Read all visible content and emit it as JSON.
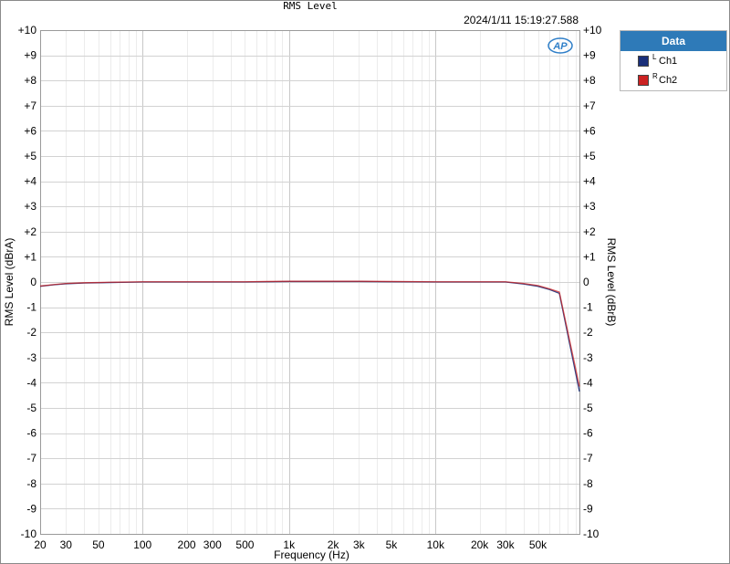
{
  "window": {
    "title": "RMS Level",
    "timestamp": "2024/1/11 15:19:27.588"
  },
  "legend": {
    "header": "Data",
    "items": [
      {
        "sup": "L",
        "label": "Ch1",
        "color": "#1a2f7a"
      },
      {
        "sup": "R",
        "label": "Ch2",
        "color": "#cc2222"
      }
    ]
  },
  "logo": {
    "text": "AP",
    "color": "#2f7fc8"
  },
  "chart_data": {
    "type": "line",
    "title": "RMS Level",
    "xlabel": "Frequency (Hz)",
    "ylabel_left": "RMS Level (dBrA)",
    "ylabel_right": "RMS Level (dBrB)",
    "x_scale": "log",
    "xlim": [
      20,
      96000
    ],
    "ylim": [
      -10,
      10
    ],
    "grid": true,
    "legend_position": "right-outside-top",
    "x_ticks": [
      {
        "v": 20,
        "l": "20"
      },
      {
        "v": 30,
        "l": "30"
      },
      {
        "v": 50,
        "l": "50"
      },
      {
        "v": 100,
        "l": "100"
      },
      {
        "v": 200,
        "l": "200"
      },
      {
        "v": 300,
        "l": "300"
      },
      {
        "v": 500,
        "l": "500"
      },
      {
        "v": 1000,
        "l": "1k"
      },
      {
        "v": 2000,
        "l": "2k"
      },
      {
        "v": 3000,
        "l": "3k"
      },
      {
        "v": 5000,
        "l": "5k"
      },
      {
        "v": 10000,
        "l": "10k"
      },
      {
        "v": 20000,
        "l": "20k"
      },
      {
        "v": 30000,
        "l": "30k"
      },
      {
        "v": 50000,
        "l": "50k"
      }
    ],
    "y_ticks": [
      {
        "v": 10,
        "l": "+10"
      },
      {
        "v": 9,
        "l": "+9"
      },
      {
        "v": 8,
        "l": "+8"
      },
      {
        "v": 7,
        "l": "+7"
      },
      {
        "v": 6,
        "l": "+6"
      },
      {
        "v": 5,
        "l": "+5"
      },
      {
        "v": 4,
        "l": "+4"
      },
      {
        "v": 3,
        "l": "+3"
      },
      {
        "v": 2,
        "l": "+2"
      },
      {
        "v": 1,
        "l": "+1"
      },
      {
        "v": 0,
        "l": "0"
      },
      {
        "v": -1,
        "l": "-1"
      },
      {
        "v": -2,
        "l": "-2"
      },
      {
        "v": -3,
        "l": "-3"
      },
      {
        "v": -4,
        "l": "-4"
      },
      {
        "v": -5,
        "l": "-5"
      },
      {
        "v": -6,
        "l": "-6"
      },
      {
        "v": -7,
        "l": "-7"
      },
      {
        "v": -8,
        "l": "-8"
      },
      {
        "v": -9,
        "l": "-9"
      },
      {
        "v": -10,
        "l": "-10"
      }
    ],
    "series": [
      {
        "name": "Ch1",
        "color": "#1a2f7a",
        "x": [
          20,
          25,
          30,
          40,
          50,
          60,
          80,
          100,
          200,
          500,
          700,
          1000,
          2000,
          3000,
          5000,
          10000,
          20000,
          30000,
          40000,
          50000,
          60000,
          70000,
          96000
        ],
        "y": [
          -0.17,
          -0.11,
          -0.07,
          -0.04,
          -0.03,
          -0.02,
          -0.01,
          0.0,
          0.0,
          0.0,
          0.01,
          0.02,
          0.02,
          0.02,
          0.01,
          0.0,
          0.0,
          0.0,
          -0.08,
          -0.17,
          -0.3,
          -0.45,
          -4.35
        ]
      },
      {
        "name": "Ch2",
        "color": "#cc2222",
        "x": [
          20,
          25,
          30,
          40,
          50,
          60,
          80,
          100,
          200,
          500,
          700,
          1000,
          2000,
          3000,
          5000,
          10000,
          20000,
          30000,
          40000,
          50000,
          60000,
          70000,
          96000
        ],
        "y": [
          -0.16,
          -0.1,
          -0.06,
          -0.03,
          -0.02,
          -0.01,
          0.0,
          0.01,
          0.01,
          0.01,
          0.02,
          0.03,
          0.03,
          0.03,
          0.02,
          0.01,
          0.01,
          0.01,
          -0.06,
          -0.14,
          -0.27,
          -0.4,
          -4.15
        ]
      }
    ]
  }
}
